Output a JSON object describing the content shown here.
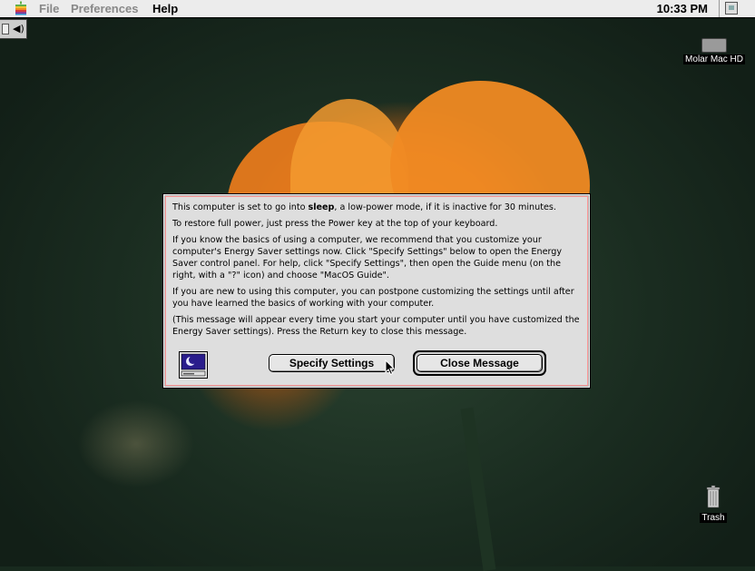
{
  "menubar": {
    "items": [
      "File",
      "Preferences",
      "Help"
    ],
    "clock": "10:33 PM"
  },
  "desktop": {
    "icons": [
      {
        "label": "Molar Mac HD",
        "icon": "hard-drive-icon"
      },
      {
        "label": "Trash",
        "icon": "trash-icon"
      }
    ]
  },
  "dialog": {
    "line1_before": "This computer is set to go into ",
    "line1_bold": "sleep",
    "line1_after": ", a low-power mode, if it is inactive for 30 minutes.",
    "line2": "To restore full power, just press the Power key at the top of your keyboard.",
    "para3": "If you know the basics of using a computer, we recommend that you customize your computer's Energy Saver settings now. Click \"Specify Settings\" below to open the Energy Saver control panel. For help, click \"Specify Settings\", then open the Guide menu (on the right, with a \"?\" icon) and choose \"MacOS Guide\".",
    "para4": "If you are new to using this computer, you can postpone customizing the settings until after you have learned the basics of working with your computer.",
    "para5": "(This message will appear every time you start your computer until you have customized the Energy Saver settings).  Press the Return key to close this message.",
    "specify_label": "Specify Settings",
    "close_label": "Close Message",
    "icon": "energy-saver-moon-icon"
  },
  "colors": {
    "flower": "#f08a23",
    "dialog_bg": "#dedede"
  }
}
